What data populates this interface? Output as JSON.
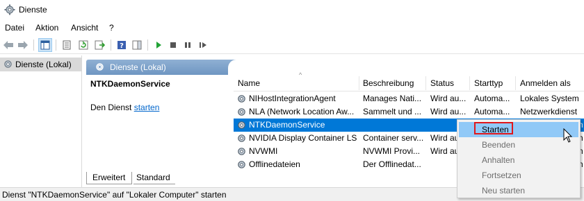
{
  "window": {
    "title": "Dienste"
  },
  "menu": [
    "Datei",
    "Aktion",
    "Ansicht",
    "?"
  ],
  "toolbar": {
    "buttons": [
      "back-arrow-icon",
      "forward-arrow-icon",
      "console-tree-icon",
      "properties-icon",
      "refresh-icon",
      "export-list-icon",
      "help-icon",
      "show-pane-icon",
      "play-icon",
      "stop-icon",
      "pause-icon",
      "restart-icon"
    ]
  },
  "tree": {
    "root": "Dienste (Lokal)"
  },
  "panel": {
    "header": "Dienste (Lokal)",
    "detail_title": "NTKDaemonService",
    "detail_prefix": "Den Dienst ",
    "detail_link": "starten"
  },
  "table": {
    "columns": [
      "Name",
      "Beschreibung",
      "Status",
      "Starttyp",
      "Anmelden als"
    ],
    "rows": [
      {
        "name": "NIHostIntegrationAgent",
        "desc": "Manages Nati...",
        "status": "Wird au...",
        "start": "Automa...",
        "logon": "Lokales System",
        "selected": false
      },
      {
        "name": "NLA (Network Location Aw...",
        "desc": "Sammelt und ...",
        "status": "Wird au...",
        "start": "Automa...",
        "logon": "Netzwerkdienst",
        "selected": false
      },
      {
        "name": "NTKDaemonService",
        "desc": "",
        "status": "",
        "start": "",
        "logon": "n",
        "selected": true
      },
      {
        "name": "NVIDIA Display Container LS",
        "desc": "Container serv...",
        "status": "Wird au",
        "start": "",
        "logon": "n",
        "selected": false
      },
      {
        "name": "NVWMI",
        "desc": "NVWMI Provi...",
        "status": "Wird au",
        "start": "",
        "logon": "n",
        "selected": false
      },
      {
        "name": "Offlinedateien",
        "desc": "Der Offlinedat...",
        "status": "",
        "start": "",
        "logon": "n",
        "selected": false
      }
    ]
  },
  "tabs": [
    "Erweitert",
    "Standard"
  ],
  "status_bar": "Dienst \"NTKDaemonService\" auf \"Lokaler Computer\" starten",
  "context_menu": [
    {
      "label": "Starten",
      "enabled": true,
      "highlighted": true
    },
    {
      "label": "Beenden",
      "enabled": false
    },
    {
      "label": "Anhalten",
      "enabled": false
    },
    {
      "label": "Fortsetzen",
      "enabled": false
    },
    {
      "label": "Neu starten",
      "enabled": false
    }
  ],
  "colors": {
    "selection": "#0078d7",
    "header_gradient": "#6f96c2",
    "menu_hover": "#91c9f7",
    "highlight_box": "#e0161a",
    "link": "#0066cc"
  }
}
